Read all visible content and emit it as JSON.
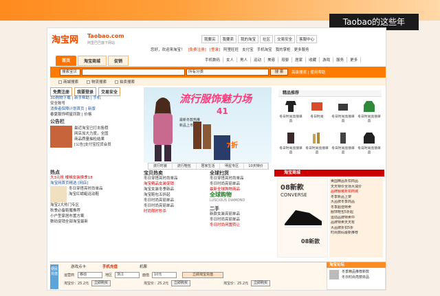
{
  "overlay": {
    "caption": "Taobao的这些年"
  },
  "header": {
    "logo": "淘宝网",
    "logo_domain": "Taobao.com",
    "logo_tag": "阿里巴巴旗下网站",
    "top_links": [
      "我要买",
      "我要卖",
      "我的淘宝",
      "社区",
      "交易安全",
      "客服中心"
    ],
    "welcome": "您好，欢迎来淘宝！",
    "welcome_links": [
      "[免费注册]",
      "[登录]",
      "阿里旺旺",
      "支付宝",
      "手机淘宝",
      "我的掌柜",
      "更多服务"
    ]
  },
  "nav": {
    "tabs": [
      "首页",
      "淘宝商城",
      "促销"
    ],
    "categories": [
      "手机数码",
      "女人",
      "男人",
      "运动",
      "美容",
      "母婴",
      "居家",
      "收藏",
      "游戏",
      "服务",
      "更多"
    ]
  },
  "search": {
    "scope": "搜索宝贝",
    "category": "所有分类",
    "button": "搜 索",
    "links": "高级搜索 | 使用帮助"
  },
  "subbar": {
    "items": [
      "商城搜索",
      "物流搜索",
      "拍卖搜索"
    ]
  },
  "left": {
    "tabs": [
      "免费注册",
      "我要登录",
      "交易安全"
    ],
    "lines": [
      "3D购物下载 | 新手帮助 | 手机",
      "安全账号",
      "消费者保障计划首页 | 新版",
      "春夏服饰明星同款 | 价格"
    ],
    "bulletin_title": "公告栏",
    "bulletin_lines": [
      "最近淘宝已打击售假",
      "网店加大力度，全国",
      "商品质量抽检结果",
      "[公告]支付宝控货会员"
    ],
    "hot_title": "热点",
    "hot_lines": [
      "大3元抢 楼梯女装换季18",
      "淘宝网首页精选 [网店]",
      "冬日穿搭亮时尚单品",
      "淘宝红蜻蜓运动鞋",
      "淘宝2大热门专区",
      "秋季必备鞋履推荐",
      "小户型家居布置方案",
      "数码促销全部淘宝最新"
    ]
  },
  "banner": {
    "headline": "流行服饰魅力场",
    "num": "41",
    "sub": "最新冬款热推",
    "sub2": "新品上市中",
    "buy": "7折",
    "tabs": [
      "流行时装",
      "流行鞋包",
      "居家生活",
      "明星专区",
      "10天特价"
    ]
  },
  "recommend": {
    "title": "精品推荐",
    "items": [
      {
        "label": "冬日时尚亮丽单品"
      },
      {
        "label": "冬日时尚"
      },
      {
        "label": "冬日时尚亮丽单品"
      },
      {
        "label": "冬日时尚亮丽单品"
      },
      {
        "label": "冬日时尚亮丽单品"
      },
      {
        "label": "冬日时尚亮丽单品"
      },
      {
        "label": "冬日时尚亮丽单品"
      },
      {
        "label": "冬日时尚亮丽单品"
      }
    ]
  },
  "middle": {
    "col1_title": "宝贝热卖",
    "col1_lines": [
      "冬日穿搭亮时尚单品",
      "淘宝精品女装促销",
      "淘宝女装冬季新品",
      "淘宝鞋包五折起",
      "冬日时尚亮丽单品",
      "冬日时尚亮丽单品",
      "时尚限时秒杀"
    ],
    "col2_title": "全球扫货",
    "col2_lines": [
      "冬日穿搭亮时尚单品",
      "冬日时尚亮丽单品",
      "最新全球购物商品"
    ],
    "col2_sub": "全球购物",
    "col2_sub2": "LUSCIOUS DIAMOND",
    "col3_title": "二手",
    "col3_lines": [
      "新款女装亮丽单品",
      "冬日时尚亮丽单品",
      "冬日时尚闲置转让"
    ]
  },
  "mall": {
    "title": "淘宝商城",
    "brand": "08新款",
    "brand_sub": "CONVERSE",
    "brand2": "08新款",
    "lines": [
      "美国精品折扣商品",
      "天天特价全场大减价",
      "品牌服装折扣商城",
      "冬季新品上架",
      "大品牌冬季商品",
      "冬季超值特卖",
      "服饰鞋包5折起",
      "运动品牌特卖中",
      "品牌特卖天天有",
      "大品牌折扣5折",
      "时尚数码最新推荐"
    ]
  },
  "bottom": {
    "strip": "便民充值",
    "tabs": [
      "游戏点卡",
      "手机充值",
      "机票"
    ],
    "labels": [
      "运营商",
      "地区",
      "面值"
    ],
    "operator": "移动",
    "region": "浙江",
    "amount": "10元",
    "submit": "立即淘宝充值",
    "prices": [
      "淘宝价：25.2元",
      "淘宝价：25.2元",
      "淘宝价：25.2元"
    ],
    "buy": "立即购买",
    "news_title": "淘宝论坛",
    "news_lines": [
      "冬季精品推荐新款",
      "冬日时尚亮丽单品"
    ]
  }
}
